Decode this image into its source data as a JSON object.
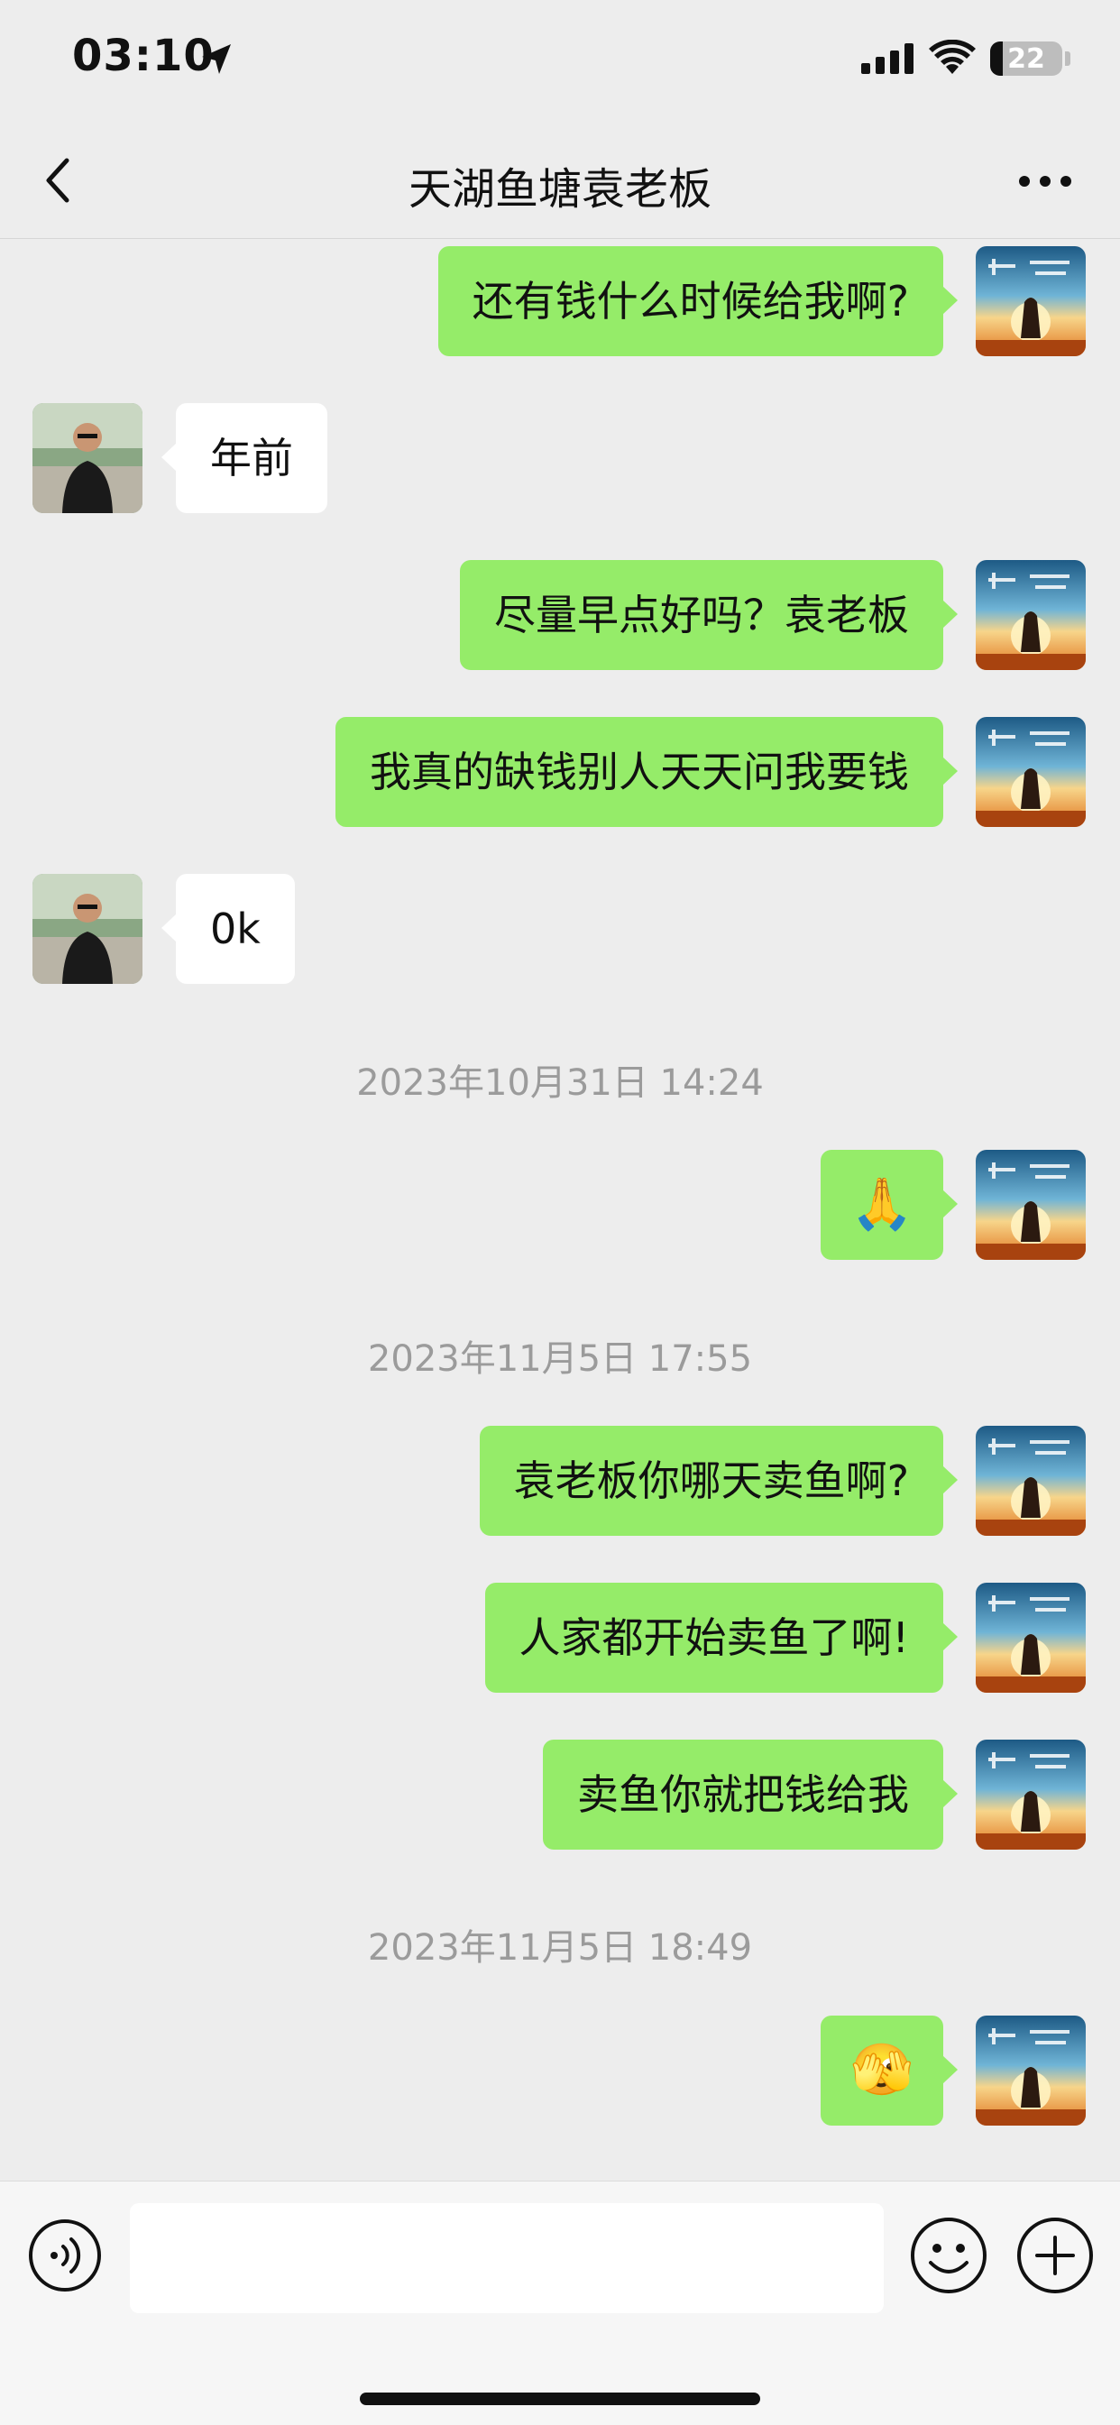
{
  "status": {
    "time": "03:10",
    "battery": "22"
  },
  "nav": {
    "title": "天湖鱼塘袁老板"
  },
  "messages": [
    {
      "text": "还有钱什么时候给我啊?"
    },
    {
      "text": "年前"
    },
    {
      "text": "尽量早点好吗？袁老板"
    },
    {
      "text": "我真的缺钱别人天天问我要钱"
    },
    {
      "text": "0k"
    },
    {
      "text": "🙏"
    },
    {
      "text": "袁老板你哪天卖鱼啊?"
    },
    {
      "text": "人家都开始卖鱼了啊!"
    },
    {
      "text": "卖鱼你就把钱给我"
    },
    {
      "text": "🫣"
    }
  ],
  "timestamps": [
    "2023年10月31日 14:24",
    "2023年11月5日 17:55",
    "2023年11月5日 18:49"
  ],
  "colors": {
    "outgoing_bubble": "#95EC69",
    "incoming_bubble": "#FFFFFF",
    "background": "#EDEDED"
  },
  "icons": [
    "location-arrow-icon",
    "signal-icon",
    "wifi-icon",
    "back-chevron-icon",
    "more-icon",
    "voice-icon",
    "emoji-icon",
    "plus-icon"
  ]
}
